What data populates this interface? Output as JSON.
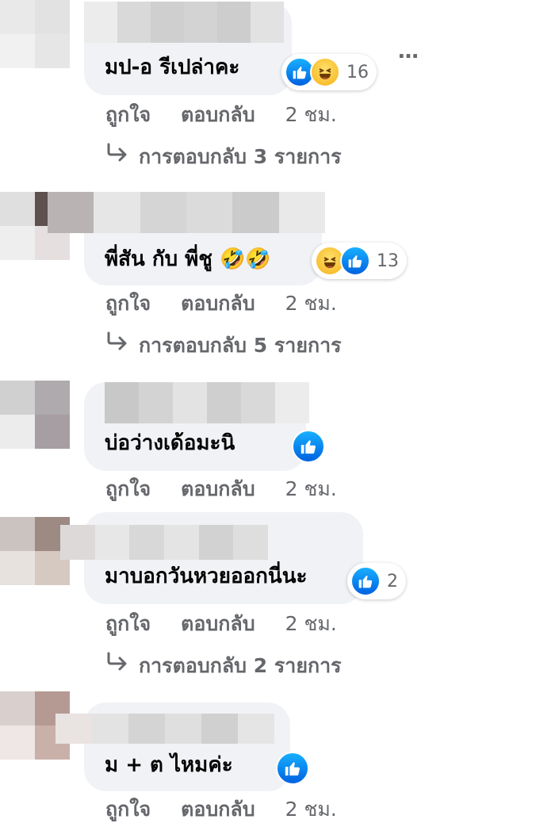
{
  "more_options_label": "…",
  "comments": [
    {
      "text": "มป-อ รีเปล่าคะ",
      "emoji_inline": "",
      "reactions": [
        "like-icon",
        "haha-icon"
      ],
      "reaction_count": "16",
      "like_label": "ถูกใจ",
      "reply_label": "ตอบกลับ",
      "time": "2 ชม.",
      "replies_text": "การตอบกลับ 3 รายการ"
    },
    {
      "text": "พี่สัน กับ พี่ชู",
      "emoji_inline": "🤣🤣",
      "reactions": [
        "haha-icon",
        "like-icon"
      ],
      "reaction_count": "13",
      "like_label": "ถูกใจ",
      "reply_label": "ตอบกลับ",
      "time": "2 ชม.",
      "replies_text": "การตอบกลับ 5 รายการ"
    },
    {
      "text": "บ่อว่างเด้อมะนิ",
      "emoji_inline": "",
      "reactions": [
        "like-icon"
      ],
      "reaction_count": "",
      "like_label": "ถูกใจ",
      "reply_label": "ตอบกลับ",
      "time": "2 ชม.",
      "replies_text": ""
    },
    {
      "text": "มาบอกวันหวยออกนี่นะ",
      "emoji_inline": "",
      "reactions": [
        "like-icon"
      ],
      "reaction_count": "2",
      "like_label": "ถูกใจ",
      "reply_label": "ตอบกลับ",
      "time": "2 ชม.",
      "replies_text": "การตอบกลับ 2 รายการ"
    },
    {
      "text": "ม + ต ไหมค่ะ",
      "emoji_inline": "",
      "reactions": [
        "like-icon"
      ],
      "reaction_count": "",
      "like_label": "ถูกใจ",
      "reply_label": "ตอบกลับ",
      "time": "2 ชม.",
      "replies_text": ""
    }
  ]
}
